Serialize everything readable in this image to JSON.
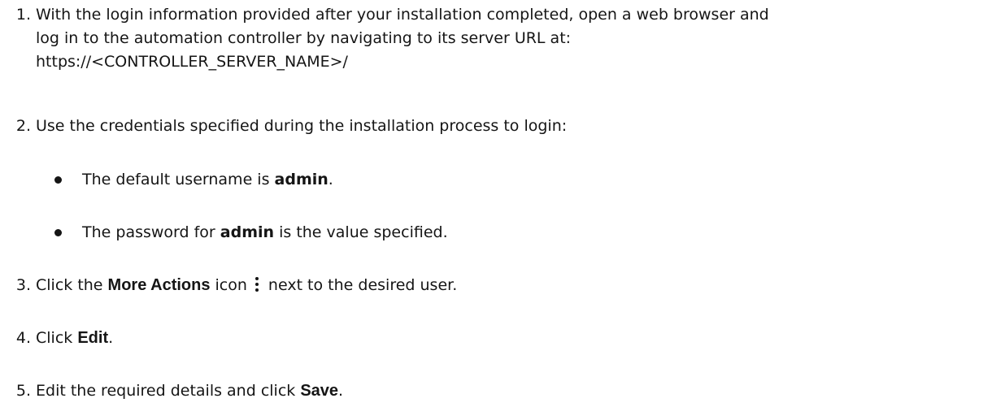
{
  "steps": [
    {
      "number": "1.",
      "lines": [
        "With the login information provided after your installation completed, open a web browser and",
        "log in to the automation controller by navigating to its server URL at:",
        "https://<CONTROLLER_SERVER_NAME>/"
      ]
    },
    {
      "number": "2.",
      "text": "Use the credentials specified during the installation process to login:",
      "bullets": [
        {
          "before": "The default username is ",
          "bold": "admin",
          "after": "."
        },
        {
          "before": "The password for ",
          "bold": "admin",
          "after": " is the value specified."
        }
      ]
    },
    {
      "number": "3.",
      "before": "Click the ",
      "bold": "More Actions",
      "middle": " icon",
      "icon": "kebab-vertical-icon",
      "after": "next to the desired user."
    },
    {
      "number": "4.",
      "before": "Click ",
      "bold": "Edit",
      "after": "."
    },
    {
      "number": "5.",
      "before": "Edit the required details and click ",
      "bold": "Save",
      "after": "."
    }
  ]
}
